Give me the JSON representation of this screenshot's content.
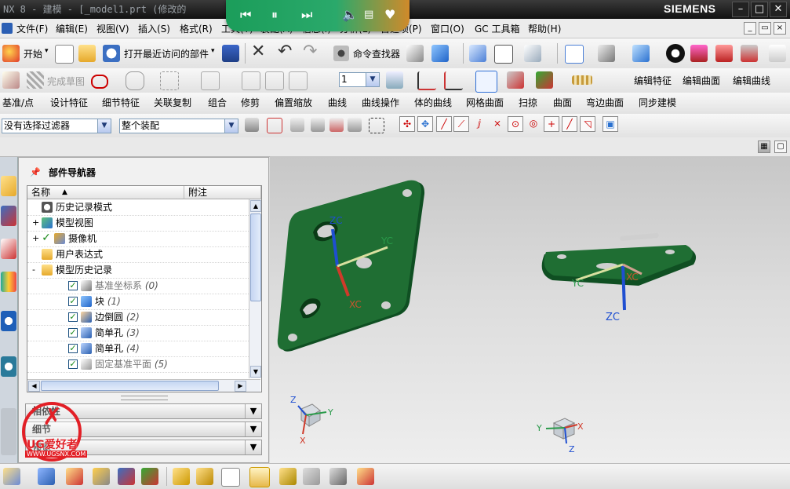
{
  "window": {
    "title": "NX 8 - 建模 - [_model1.prt  (修改的",
    "brand": "SIEMENS"
  },
  "media_overlay": {
    "icons": [
      "prev-icon",
      "pause-icon",
      "next-icon",
      "volume-icon",
      "playlist-icon",
      "heart-icon"
    ]
  },
  "menu": {
    "items": [
      "文件(F)",
      "编辑(E)",
      "视图(V)",
      "插入(S)",
      "格式(R)",
      "工具(T)",
      "装配(A)",
      "信息(I)",
      "分析(L)",
      "首选项(P)",
      "窗口(O)",
      "GC 工具箱",
      "帮助(H)"
    ]
  },
  "toolbar1": {
    "start_label": "开始",
    "recent_label": "打开最近访问的部件",
    "command_finder_label": "命令查找器"
  },
  "toolbar2": {
    "finish_sketch_label": "完成草图",
    "layer_value": "1",
    "edit_feature_label": "编辑特征",
    "edit_surface_label": "编辑曲面",
    "edit_curve_label": "编辑曲线"
  },
  "toolbar3": {
    "items": [
      "基准/点",
      "设计特征",
      "细节特征",
      "关联复制",
      "组合",
      "修剪",
      "偏置缩放",
      "曲线",
      "曲线操作",
      "体的曲线",
      "网格曲面",
      "扫掠",
      "曲面",
      "弯边曲面",
      "同步建模"
    ]
  },
  "selection_bar": {
    "filter_value": "没有选择过滤器",
    "scope_value": "整个装配"
  },
  "navigator": {
    "title": "部件导航器",
    "col_name": "名称",
    "col_note": "附注",
    "rows": [
      {
        "label": "历史记录模式",
        "indent": 0,
        "expand": "",
        "check": false,
        "icon": "clock-icon",
        "suffix": ""
      },
      {
        "label": "模型视图",
        "indent": 0,
        "expand": "+",
        "check": false,
        "icon": "views-icon",
        "suffix": ""
      },
      {
        "label": "摄像机",
        "indent": 0,
        "expand": "+",
        "check": true,
        "icon": "camera-icon",
        "suffix": ""
      },
      {
        "label": "用户表达式",
        "indent": 0,
        "expand": "",
        "check": false,
        "icon": "folder-icon",
        "suffix": ""
      },
      {
        "label": "模型历史记录",
        "indent": 0,
        "expand": "-",
        "check": false,
        "icon": "folder-icon",
        "suffix": ""
      },
      {
        "label": "基准坐标系",
        "indent": 1,
        "expand": "",
        "check": true,
        "icon": "csys-icon",
        "suffix": "(0)",
        "dim": true
      },
      {
        "label": "块",
        "indent": 1,
        "expand": "",
        "check": true,
        "icon": "block-icon",
        "suffix": "(1)"
      },
      {
        "label": "边倒圆",
        "indent": 1,
        "expand": "",
        "check": true,
        "icon": "blend-icon",
        "suffix": "(2)"
      },
      {
        "label": "简单孔",
        "indent": 1,
        "expand": "",
        "check": true,
        "icon": "hole-icon",
        "suffix": "(3)"
      },
      {
        "label": "简单孔",
        "indent": 1,
        "expand": "",
        "check": true,
        "icon": "hole-icon",
        "suffix": "(4)"
      },
      {
        "label": "固定基准平面",
        "indent": 1,
        "expand": "",
        "check": true,
        "icon": "plane-icon",
        "suffix": "(5)",
        "dim": true
      }
    ],
    "panels": [
      "相依性",
      "细节",
      "预览"
    ]
  },
  "graphics": {
    "axes_left": {
      "x": "XC",
      "y": "YC",
      "z": "ZC"
    },
    "axes_right": {
      "x": "XC",
      "y": "YC",
      "z": "ZC"
    },
    "triad_left": {
      "x": "X",
      "y": "Y",
      "z": "Z"
    },
    "triad_right": {
      "x": "X",
      "y": "Y",
      "z": "Z"
    }
  },
  "watermark": {
    "text": "UG爱好者",
    "url": "WWW.UGSNX.COM"
  },
  "colors": {
    "part_green": "#1f6e33",
    "titlebar": "#1a1a1a",
    "accent_blue": "#2f6fd6"
  }
}
